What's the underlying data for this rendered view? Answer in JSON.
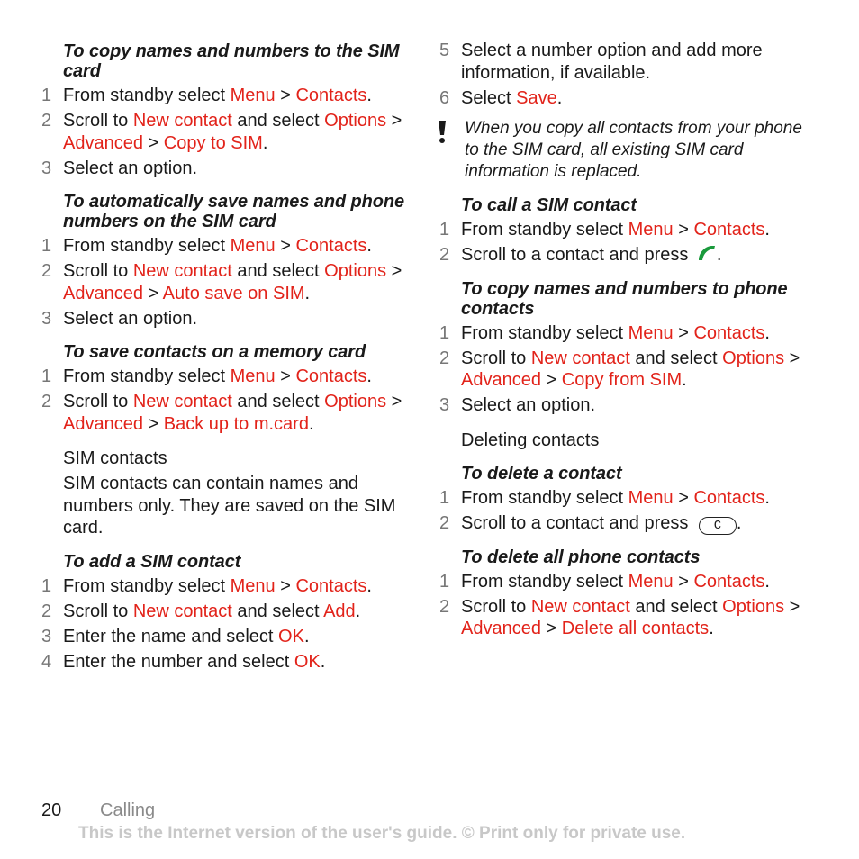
{
  "left_column": {
    "copy_to_sim": {
      "heading": "To copy names and numbers to the SIM card",
      "steps": [
        {
          "n": "1",
          "parts": [
            [
              "t",
              "From standby select "
            ],
            [
              "r",
              "Menu"
            ],
            [
              "t",
              " > "
            ],
            [
              "r",
              "Contacts"
            ],
            [
              "t",
              "."
            ]
          ]
        },
        {
          "n": "2",
          "parts": [
            [
              "t",
              "Scroll to "
            ],
            [
              "r",
              "New contact"
            ],
            [
              "t",
              " and select "
            ],
            [
              "r",
              "Options"
            ],
            [
              "t",
              " > "
            ],
            [
              "r",
              "Advanced"
            ],
            [
              "t",
              " > "
            ],
            [
              "r",
              "Copy to SIM"
            ],
            [
              "t",
              "."
            ]
          ]
        },
        {
          "n": "3",
          "parts": [
            [
              "t",
              "Select an option."
            ]
          ]
        }
      ]
    },
    "auto_save": {
      "heading": "To automatically save names and phone numbers on the SIM card",
      "steps": [
        {
          "n": "1",
          "parts": [
            [
              "t",
              "From standby select "
            ],
            [
              "r",
              "Menu"
            ],
            [
              "t",
              " > "
            ],
            [
              "r",
              "Contacts"
            ],
            [
              "t",
              "."
            ]
          ]
        },
        {
          "n": "2",
          "parts": [
            [
              "t",
              "Scroll to "
            ],
            [
              "r",
              "New contact"
            ],
            [
              "t",
              " and select "
            ],
            [
              "r",
              "Options"
            ],
            [
              "t",
              " > "
            ],
            [
              "r",
              "Advanced"
            ],
            [
              "t",
              " > "
            ],
            [
              "r",
              "Auto save on SIM"
            ],
            [
              "t",
              "."
            ]
          ]
        },
        {
          "n": "3",
          "parts": [
            [
              "t",
              "Select an option."
            ]
          ]
        }
      ]
    },
    "memory_card": {
      "heading": "To save contacts on a memory card",
      "steps": [
        {
          "n": "1",
          "parts": [
            [
              "t",
              "From standby select "
            ],
            [
              "r",
              "Menu"
            ],
            [
              "t",
              " > "
            ],
            [
              "r",
              "Contacts"
            ],
            [
              "t",
              "."
            ]
          ]
        },
        {
          "n": "2",
          "parts": [
            [
              "t",
              "Scroll to "
            ],
            [
              "r",
              "New contact"
            ],
            [
              "t",
              " and select "
            ],
            [
              "r",
              "Options"
            ],
            [
              "t",
              " > "
            ],
            [
              "r",
              "Advanced"
            ],
            [
              "t",
              " > "
            ],
            [
              "r",
              "Back up to m.card"
            ],
            [
              "t",
              "."
            ]
          ]
        }
      ]
    },
    "sim_contacts": {
      "title": "SIM contacts",
      "body": "SIM contacts can contain names and numbers only. They are saved on the SIM card."
    },
    "add_sim_contact": {
      "heading": "To add a SIM contact",
      "steps": [
        {
          "n": "1",
          "parts": [
            [
              "t",
              "From standby select "
            ],
            [
              "r",
              "Menu"
            ],
            [
              "t",
              " > "
            ],
            [
              "r",
              "Contacts"
            ],
            [
              "t",
              "."
            ]
          ]
        },
        {
          "n": "2",
          "parts": [
            [
              "t",
              "Scroll to "
            ],
            [
              "r",
              "New contact"
            ],
            [
              "t",
              " and select "
            ],
            [
              "r",
              "Add"
            ],
            [
              "t",
              "."
            ]
          ]
        },
        {
          "n": "3",
          "parts": [
            [
              "t",
              "Enter the name and select "
            ],
            [
              "r",
              "OK"
            ],
            [
              "t",
              "."
            ]
          ]
        },
        {
          "n": "4",
          "parts": [
            [
              "t",
              "Enter the number and select "
            ],
            [
              "r",
              "OK"
            ],
            [
              "t",
              "."
            ]
          ]
        }
      ]
    }
  },
  "right_column": {
    "continued_steps": [
      {
        "n": "5",
        "parts": [
          [
            "t",
            "Select a number option and add more information, if available."
          ]
        ]
      },
      {
        "n": "6",
        "parts": [
          [
            "t",
            "Select "
          ],
          [
            "r",
            "Save"
          ],
          [
            "t",
            "."
          ]
        ]
      }
    ],
    "note": {
      "icon": "exclamation-icon",
      "text": "When you copy all contacts from your phone to the SIM card, all existing SIM card information is replaced."
    },
    "call_sim_contact": {
      "heading": "To call a SIM contact",
      "steps": [
        {
          "n": "1",
          "parts": [
            [
              "t",
              "From standby select "
            ],
            [
              "r",
              "Menu"
            ],
            [
              "t",
              " > "
            ],
            [
              "r",
              "Contacts"
            ],
            [
              "t",
              "."
            ]
          ]
        },
        {
          "n": "2",
          "parts": [
            [
              "t",
              "Scroll to a contact and press "
            ],
            [
              "icon",
              "call-key-icon"
            ],
            [
              "t",
              "."
            ]
          ]
        }
      ]
    },
    "copy_to_phone": {
      "heading": "To copy names and numbers to phone contacts",
      "steps": [
        {
          "n": "1",
          "parts": [
            [
              "t",
              "From standby select "
            ],
            [
              "r",
              "Menu"
            ],
            [
              "t",
              " > "
            ],
            [
              "r",
              "Contacts"
            ],
            [
              "t",
              "."
            ]
          ]
        },
        {
          "n": "2",
          "parts": [
            [
              "t",
              "Scroll to "
            ],
            [
              "r",
              "New contact"
            ],
            [
              "t",
              " and select "
            ],
            [
              "r",
              "Options"
            ],
            [
              "t",
              " > "
            ],
            [
              "r",
              "Advanced"
            ],
            [
              "t",
              " > "
            ],
            [
              "r",
              "Copy from SIM"
            ],
            [
              "t",
              "."
            ]
          ]
        },
        {
          "n": "3",
          "parts": [
            [
              "t",
              "Select an option."
            ]
          ]
        }
      ]
    },
    "deleting_contacts": {
      "title": "Deleting contacts"
    },
    "delete_contact": {
      "heading": "To delete a contact",
      "steps": [
        {
          "n": "1",
          "parts": [
            [
              "t",
              "From standby select "
            ],
            [
              "r",
              "Menu"
            ],
            [
              "t",
              " > "
            ],
            [
              "r",
              "Contacts"
            ],
            [
              "t",
              "."
            ]
          ]
        },
        {
          "n": "2",
          "parts": [
            [
              "t",
              "Scroll to a contact and press "
            ],
            [
              "key",
              "C"
            ],
            [
              "t",
              "."
            ]
          ]
        }
      ]
    },
    "delete_all": {
      "heading": "To delete all phone contacts",
      "steps": [
        {
          "n": "1",
          "parts": [
            [
              "t",
              "From standby select "
            ],
            [
              "r",
              "Menu"
            ],
            [
              "t",
              " > "
            ],
            [
              "r",
              "Contacts"
            ],
            [
              "t",
              "."
            ]
          ]
        },
        {
          "n": "2",
          "parts": [
            [
              "t",
              "Scroll to "
            ],
            [
              "r",
              "New contact"
            ],
            [
              "t",
              " and select "
            ],
            [
              "r",
              "Options"
            ],
            [
              "t",
              " > "
            ],
            [
              "r",
              "Advanced"
            ],
            [
              "t",
              " > "
            ],
            [
              "r",
              "Delete all contacts"
            ],
            [
              "t",
              "."
            ]
          ]
        }
      ]
    }
  },
  "footer": {
    "page_number": "20",
    "section": "Calling",
    "notice": "This is the Internet version of the user's guide. © Print only for private use."
  },
  "colors": {
    "menu_link": "#e2231a",
    "step_number": "#777777",
    "call_key": "#1a9a3c",
    "notice": "#c8c8c8"
  }
}
